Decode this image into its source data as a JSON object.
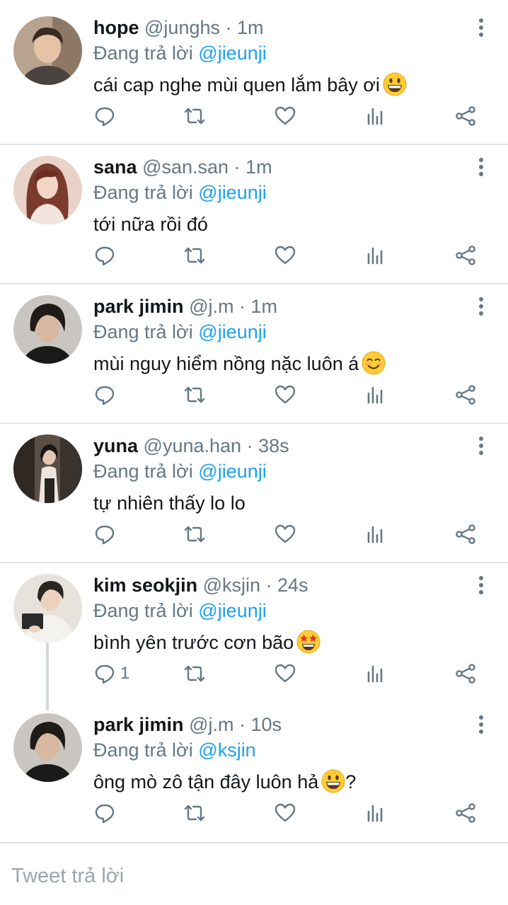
{
  "colors": {
    "accent": "#1da1f2",
    "muted": "#657786",
    "divider": "#e1e4e6"
  },
  "tweets": [
    {
      "name": "hope",
      "handle": "@junghs",
      "time": "1m",
      "reply_prefix": "Đang trả lời",
      "reply_to": "@jieunji",
      "text": "cái cap nghe mùi quen lắm bây ơi",
      "emoji": "grinning-face",
      "text_suffix": "",
      "reply_count": ""
    },
    {
      "name": "sana",
      "handle": "@san.san",
      "time": "1m",
      "reply_prefix": "Đang trả lời",
      "reply_to": "@jieunji",
      "text": "tới nữa rồi đó",
      "emoji": "",
      "text_suffix": "",
      "reply_count": ""
    },
    {
      "name": "park jimin",
      "handle": "@j.m",
      "time": "1m",
      "reply_prefix": "Đang trả lời",
      "reply_to": "@jieunji",
      "text": "mùi nguy hiểm nồng nặc luôn á",
      "emoji": "smiling-face",
      "text_suffix": "",
      "reply_count": ""
    },
    {
      "name": "yuna",
      "handle": "@yuna.han",
      "time": "38s",
      "reply_prefix": "Đang trả lời",
      "reply_to": "@jieunji",
      "text": "tự nhiên thấy lo lo",
      "emoji": "",
      "text_suffix": "",
      "reply_count": ""
    },
    {
      "name": "kim seokjin",
      "handle": "@ksjin",
      "time": "24s",
      "reply_prefix": "Đang trả lời",
      "reply_to": "@jieunji",
      "text": "bình yên trước cơn bão",
      "emoji": "star-struck-face",
      "text_suffix": "",
      "reply_count": "1"
    },
    {
      "name": "park jimin",
      "handle": "@j.m",
      "time": "10s",
      "reply_prefix": "Đang trả lời",
      "reply_to": "@ksjin",
      "text": "ông mò zô tận đây luôn hả",
      "emoji": "grinning-face",
      "text_suffix": "?",
      "reply_count": ""
    }
  ],
  "compose": {
    "placeholder": "Tweet trả lời"
  }
}
